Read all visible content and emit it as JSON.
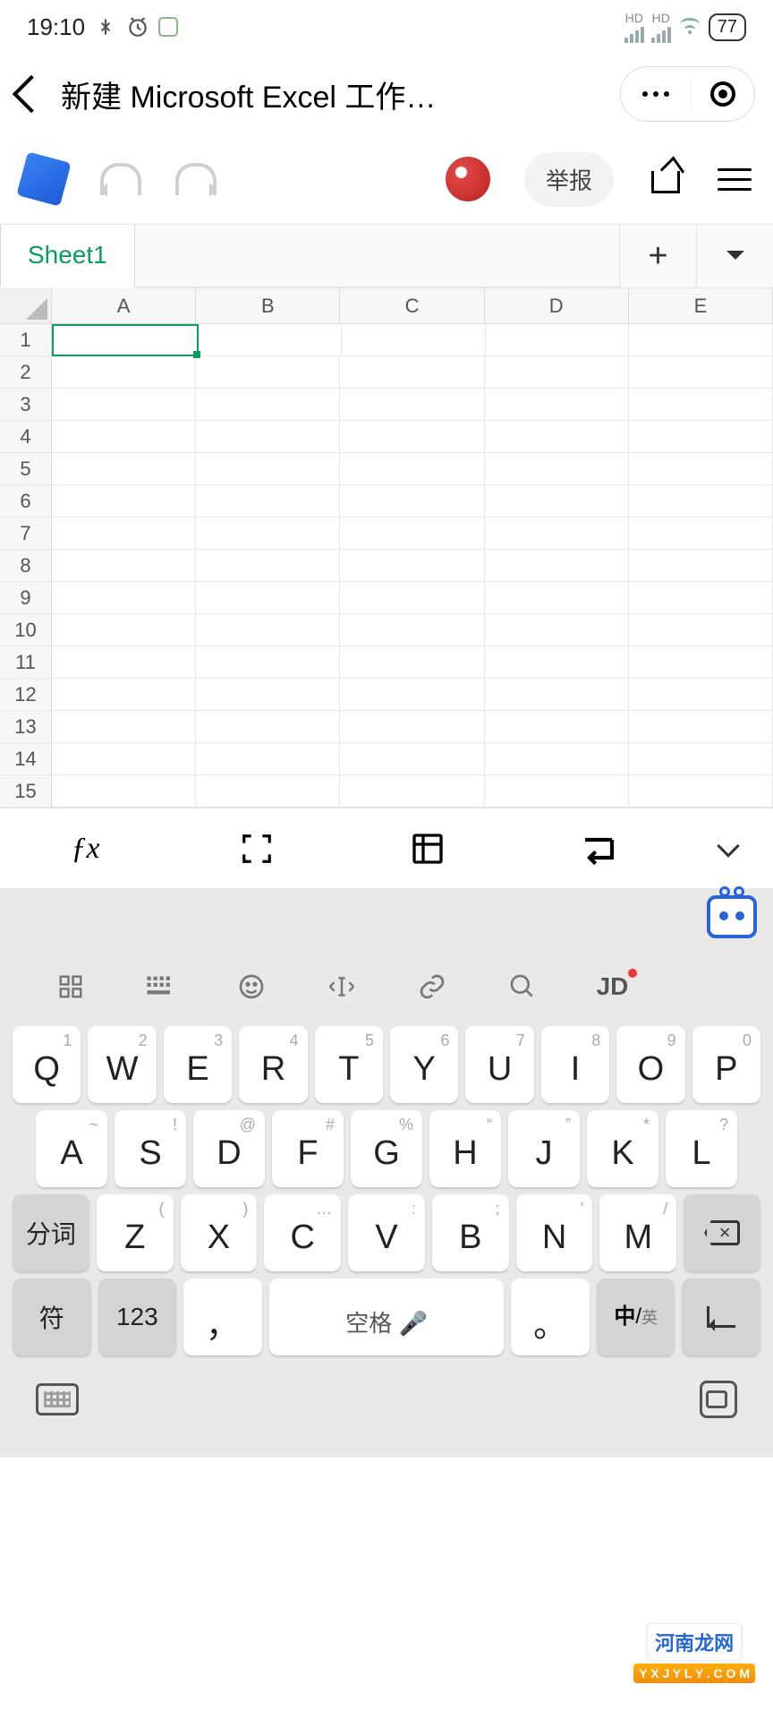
{
  "status": {
    "time": "19:10",
    "hd": "HD",
    "battery": "77"
  },
  "header": {
    "title": "新建 Microsoft Excel 工作…"
  },
  "toolbar": {
    "report": "举报"
  },
  "sheet": {
    "tab": "Sheet1",
    "cols": [
      "A",
      "B",
      "C",
      "D",
      "E"
    ],
    "rows": [
      "1",
      "2",
      "3",
      "4",
      "5",
      "6",
      "7",
      "8",
      "9",
      "10",
      "11",
      "12",
      "13",
      "14",
      "15"
    ]
  },
  "kbd": {
    "jd": "JD",
    "row1": [
      {
        "s": "1",
        "m": "Q"
      },
      {
        "s": "2",
        "m": "W"
      },
      {
        "s": "3",
        "m": "E"
      },
      {
        "s": "4",
        "m": "R"
      },
      {
        "s": "5",
        "m": "T"
      },
      {
        "s": "6",
        "m": "Y"
      },
      {
        "s": "7",
        "m": "U"
      },
      {
        "s": "8",
        "m": "I"
      },
      {
        "s": "9",
        "m": "O"
      },
      {
        "s": "0",
        "m": "P"
      }
    ],
    "row2": [
      {
        "s": "~",
        "m": "A"
      },
      {
        "s": "!",
        "m": "S"
      },
      {
        "s": "@",
        "m": "D"
      },
      {
        "s": "#",
        "m": "F"
      },
      {
        "s": "%",
        "m": "G"
      },
      {
        "s": "“",
        "m": "H"
      },
      {
        "s": "”",
        "m": "J"
      },
      {
        "s": "*",
        "m": "K"
      },
      {
        "s": "?",
        "m": "L"
      }
    ],
    "row3": [
      {
        "s": "(",
        "m": "Z"
      },
      {
        "s": ")",
        "m": "X"
      },
      {
        "s": "…",
        "m": "C"
      },
      {
        "s": ":",
        "m": "V"
      },
      {
        "s": ";",
        "m": "B"
      },
      {
        "s": "'",
        "m": "N"
      },
      {
        "s": "/",
        "m": "M"
      }
    ],
    "fenci": "分词",
    "fu": "符",
    "num": "123",
    "space": "空格 🎤",
    "lang_top": "中",
    "lang_bot": "英",
    "comma": "，",
    "period": "。"
  },
  "watermark": {
    "line1": "河南龙网",
    "line2": "Y X J Y L Y . C O M"
  }
}
